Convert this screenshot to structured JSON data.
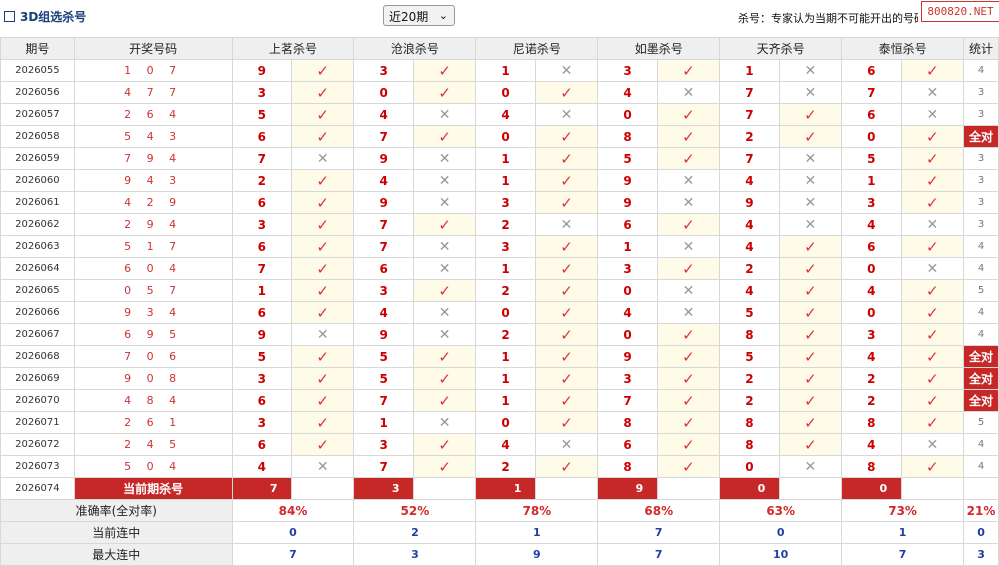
{
  "header": {
    "title": "3D组选杀号",
    "period_select": "近20期",
    "note": "杀号：专家认为当期不可能开出的号码",
    "watermark": "800820.NET"
  },
  "columns": {
    "period": "期号",
    "draw": "开奖号码",
    "stat": "统计",
    "experts": [
      "上茗杀号",
      "沧浪杀号",
      "尼诺杀号",
      "如墨杀号",
      "天齐杀号",
      "泰恒杀号"
    ]
  },
  "symbols": {
    "ok": "✓",
    "bad": "✕"
  },
  "rows": [
    {
      "period": "2026055",
      "draw": "1 0 7",
      "kills": [
        9,
        3,
        1,
        3,
        1,
        6
      ],
      "hits": [
        1,
        1,
        0,
        1,
        0,
        1
      ],
      "stat": "4"
    },
    {
      "period": "2026056",
      "draw": "4 7 7",
      "kills": [
        3,
        0,
        0,
        4,
        7,
        7
      ],
      "hits": [
        1,
        1,
        1,
        0,
        0,
        0
      ],
      "stat": "3"
    },
    {
      "period": "2026057",
      "draw": "2 6 4",
      "kills": [
        5,
        4,
        4,
        0,
        7,
        6
      ],
      "hits": [
        1,
        0,
        0,
        1,
        1,
        0
      ],
      "stat": "3"
    },
    {
      "period": "2026058",
      "draw": "5 4 3",
      "kills": [
        6,
        7,
        0,
        8,
        2,
        0
      ],
      "hits": [
        1,
        1,
        1,
        1,
        1,
        1
      ],
      "stat": "全对"
    },
    {
      "period": "2026059",
      "draw": "7 9 4",
      "kills": [
        7,
        9,
        1,
        5,
        7,
        5
      ],
      "hits": [
        0,
        0,
        1,
        1,
        0,
        1
      ],
      "stat": "3"
    },
    {
      "period": "2026060",
      "draw": "9 4 3",
      "kills": [
        2,
        4,
        1,
        9,
        4,
        1
      ],
      "hits": [
        1,
        0,
        1,
        0,
        0,
        1
      ],
      "stat": "3"
    },
    {
      "period": "2026061",
      "draw": "4 2 9",
      "kills": [
        6,
        9,
        3,
        9,
        9,
        3
      ],
      "hits": [
        1,
        0,
        1,
        0,
        0,
        1
      ],
      "stat": "3"
    },
    {
      "period": "2026062",
      "draw": "2 9 4",
      "kills": [
        3,
        7,
        2,
        6,
        4,
        4
      ],
      "hits": [
        1,
        1,
        0,
        1,
        0,
        0
      ],
      "stat": "3"
    },
    {
      "period": "2026063",
      "draw": "5 1 7",
      "kills": [
        6,
        7,
        3,
        1,
        4,
        6
      ],
      "hits": [
        1,
        0,
        1,
        0,
        1,
        1
      ],
      "stat": "4"
    },
    {
      "period": "2026064",
      "draw": "6 0 4",
      "kills": [
        7,
        6,
        1,
        3,
        2,
        0
      ],
      "hits": [
        1,
        0,
        1,
        1,
        1,
        0
      ],
      "stat": "4"
    },
    {
      "period": "2026065",
      "draw": "0 5 7",
      "kills": [
        1,
        3,
        2,
        0,
        4,
        4
      ],
      "hits": [
        1,
        1,
        1,
        0,
        1,
        1
      ],
      "stat": "5"
    },
    {
      "period": "2026066",
      "draw": "9 3 4",
      "kills": [
        6,
        4,
        0,
        4,
        5,
        0
      ],
      "hits": [
        1,
        0,
        1,
        0,
        1,
        1
      ],
      "stat": "4"
    },
    {
      "period": "2026067",
      "draw": "6 9 5",
      "kills": [
        9,
        9,
        2,
        0,
        8,
        3
      ],
      "hits": [
        0,
        0,
        1,
        1,
        1,
        1
      ],
      "stat": "4"
    },
    {
      "period": "2026068",
      "draw": "7 0 6",
      "kills": [
        5,
        5,
        1,
        9,
        5,
        4
      ],
      "hits": [
        1,
        1,
        1,
        1,
        1,
        1
      ],
      "stat": "全对"
    },
    {
      "period": "2026069",
      "draw": "9 0 8",
      "kills": [
        3,
        5,
        1,
        3,
        2,
        2
      ],
      "hits": [
        1,
        1,
        1,
        1,
        1,
        1
      ],
      "stat": "全对"
    },
    {
      "period": "2026070",
      "draw": "4 8 4",
      "kills": [
        6,
        7,
        1,
        7,
        2,
        2
      ],
      "hits": [
        1,
        1,
        1,
        1,
        1,
        1
      ],
      "stat": "全对"
    },
    {
      "period": "2026071",
      "draw": "2 6 1",
      "kills": [
        3,
        1,
        0,
        8,
        8,
        8
      ],
      "hits": [
        1,
        0,
        1,
        1,
        1,
        1
      ],
      "stat": "5"
    },
    {
      "period": "2026072",
      "draw": "2 4 5",
      "kills": [
        6,
        3,
        4,
        6,
        8,
        4
      ],
      "hits": [
        1,
        1,
        0,
        1,
        1,
        0
      ],
      "stat": "4"
    },
    {
      "period": "2026073",
      "draw": "5 0 4",
      "kills": [
        4,
        7,
        2,
        8,
        0,
        8
      ],
      "hits": [
        0,
        1,
        1,
        1,
        0,
        1
      ],
      "stat": "4"
    }
  ],
  "current": {
    "period": "2026074",
    "label": "当前期杀号",
    "kills": [
      7,
      3,
      1,
      9,
      0,
      0
    ]
  },
  "summary": {
    "accuracy_label": "准确率(全对率)",
    "accuracy": [
      "84%",
      "52%",
      "78%",
      "68%",
      "63%",
      "73%"
    ],
    "accuracy_stat": "21%",
    "current_streak_label": "当前连中",
    "current_streak": [
      0,
      2,
      1,
      7,
      0,
      1
    ],
    "current_streak_stat": "0",
    "max_streak_label": "最大连中",
    "max_streak": [
      7,
      3,
      9,
      7,
      10,
      7
    ],
    "max_streak_stat": "3"
  },
  "colors": {
    "accent_red": "#c62828",
    "tick_red": "#e0313b",
    "streak_blue": "#1f3fa0"
  }
}
